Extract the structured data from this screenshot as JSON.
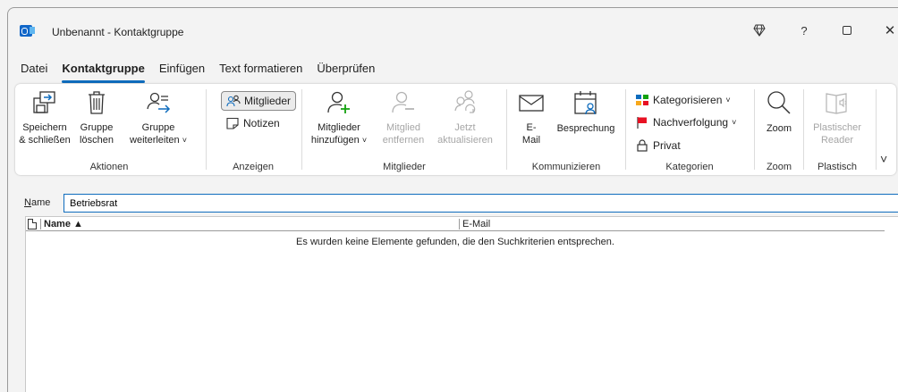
{
  "window": {
    "title": "Unbenannt - Kontaktgruppe",
    "controls": {
      "diamond": "◇",
      "help": "?",
      "close": "✕"
    }
  },
  "tabs": [
    {
      "label": "Datei"
    },
    {
      "label": "Kontaktgruppe",
      "active": true
    },
    {
      "label": "Einfügen"
    },
    {
      "label": "Text formatieren"
    },
    {
      "label": "Überprüfen"
    }
  ],
  "ribbon": {
    "aktionen": {
      "label": "Aktionen",
      "save_line1": "Speichern",
      "save_line2": "& schließen",
      "delete_line1": "Gruppe",
      "delete_line2": "löschen",
      "forward_line1": "Gruppe",
      "forward_line2": "weiterleiten"
    },
    "anzeigen": {
      "label": "Anzeigen",
      "members": "Mitglieder",
      "notes": "Notizen"
    },
    "mitglieder": {
      "label": "Mitglieder",
      "add_line1": "Mitglieder",
      "add_line2": "hinzufügen",
      "remove_line1": "Mitglied",
      "remove_line2": "entfernen",
      "update_line1": "Jetzt",
      "update_line2": "aktualisieren"
    },
    "kommunizieren": {
      "label": "Kommunizieren",
      "email_line1": "E-",
      "email_line2": "Mail",
      "meeting": "Besprechung"
    },
    "kategorien": {
      "label": "Kategorien",
      "categorize": "Kategorisieren",
      "followup": "Nachverfolgung",
      "private": "Privat"
    },
    "zoom": {
      "label": "Zoom",
      "zoom": "Zoom"
    },
    "plastisch": {
      "label": "Plastisch",
      "reader_line1": "Plastischer",
      "reader_line2": "Reader"
    },
    "chevron": "˅",
    "colors": {
      "accent": "#0f6cbd",
      "green": "#13a10e",
      "red": "#e81123"
    }
  },
  "form": {
    "name_label_u": "N",
    "name_label_rest": "ame",
    "name_value": "Betriebsrat"
  },
  "list": {
    "col_name": "Name ▲",
    "col_email": "E-Mail",
    "empty_message": "Es wurden keine Elemente gefunden, die den Suchkriterien entsprechen."
  }
}
